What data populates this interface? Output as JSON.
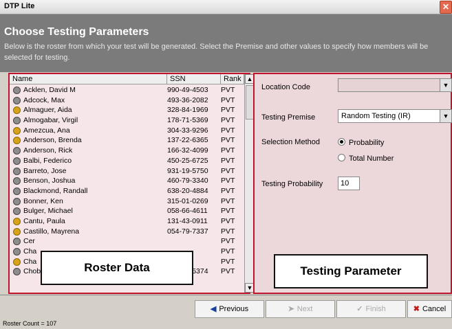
{
  "window": {
    "title": "DTP Lite",
    "close_icon": "close-icon"
  },
  "header": {
    "title": "Choose Testing Parameters",
    "subtitle": "Below is the roster from which your test will be generated.  Select the Premise and other values to specify how members will be selected for testing."
  },
  "roster": {
    "columns": [
      "Name",
      "SSN",
      "Rank"
    ],
    "rows": [
      {
        "name": "Acklen, David M",
        "ssn": "990-49-4503",
        "rank": "PVT",
        "icon": "male-person-icon"
      },
      {
        "name": "Adcock, Max",
        "ssn": "493-36-2082",
        "rank": "PVT",
        "icon": "male-person-icon"
      },
      {
        "name": "Almaguer, Aida",
        "ssn": "328-84-1969",
        "rank": "PVT",
        "icon": "female-person-icon"
      },
      {
        "name": "Almogabar, Virgil",
        "ssn": "178-71-5369",
        "rank": "PVT",
        "icon": "male-person-icon"
      },
      {
        "name": "Amezcua, Ana",
        "ssn": "304-33-9296",
        "rank": "PVT",
        "icon": "female-person-icon"
      },
      {
        "name": "Anderson, Brenda",
        "ssn": "137-22-6365",
        "rank": "PVT",
        "icon": "female-person-icon"
      },
      {
        "name": "Anderson, Rick",
        "ssn": "166-32-4099",
        "rank": "PVT",
        "icon": "male-person-icon"
      },
      {
        "name": "Balbi, Federico",
        "ssn": "450-25-6725",
        "rank": "PVT",
        "icon": "male-person-icon"
      },
      {
        "name": "Barreto, Jose",
        "ssn": "931-19-5750",
        "rank": "PVT",
        "icon": "male-person-icon"
      },
      {
        "name": "Benson, Joshua",
        "ssn": "460-79-3340",
        "rank": "PVT",
        "icon": "male-person-icon"
      },
      {
        "name": "Blackmond, Randall",
        "ssn": "638-20-4884",
        "rank": "PVT",
        "icon": "male-person-icon"
      },
      {
        "name": "Bonner, Ken",
        "ssn": "315-01-0269",
        "rank": "PVT",
        "icon": "male-person-icon"
      },
      {
        "name": "Bulger, Michael",
        "ssn": "058-66-4611",
        "rank": "PVT",
        "icon": "male-person-icon"
      },
      {
        "name": "Cantu, Paula",
        "ssn": "131-43-0911",
        "rank": "PVT",
        "icon": "female-person-icon"
      },
      {
        "name": "Castillo, Mayrena",
        "ssn": "054-79-7337",
        "rank": "PVT",
        "icon": "female-person-icon"
      },
      {
        "name": "Cer",
        "ssn": "",
        "rank": "PVT",
        "icon": "male-person-icon"
      },
      {
        "name": "Cha",
        "ssn": "",
        "rank": "PVT",
        "icon": "male-person-icon"
      },
      {
        "name": "Cha",
        "ssn": "",
        "rank": "PVT",
        "icon": "female-person-icon"
      },
      {
        "name": "Choban, Greg",
        "ssn": "895-73-5374",
        "rank": "PVT",
        "icon": "male-person-icon"
      }
    ],
    "overlay_label": "Roster Data",
    "count_text": "Roster Count = 107"
  },
  "params": {
    "location_label": "Location Code",
    "location_value": "",
    "premise_label": "Testing Premise",
    "premise_value": "Random Testing (IR)",
    "method_label": "Selection Method",
    "method_options": [
      "Probability",
      "Total Number"
    ],
    "method_selected": "Probability",
    "probability_label": "Testing Probability",
    "probability_value": "10",
    "overlay_label": "Testing Parameter"
  },
  "buttons": {
    "previous": "Previous",
    "next": "Next",
    "finish": "Finish",
    "cancel": "Cancel"
  },
  "colors": {
    "highlight_border": "#c0122a",
    "header_bg": "#7b7b7b",
    "roster_bg": "#f6e6e9",
    "params_bg": "#ecd7db"
  }
}
